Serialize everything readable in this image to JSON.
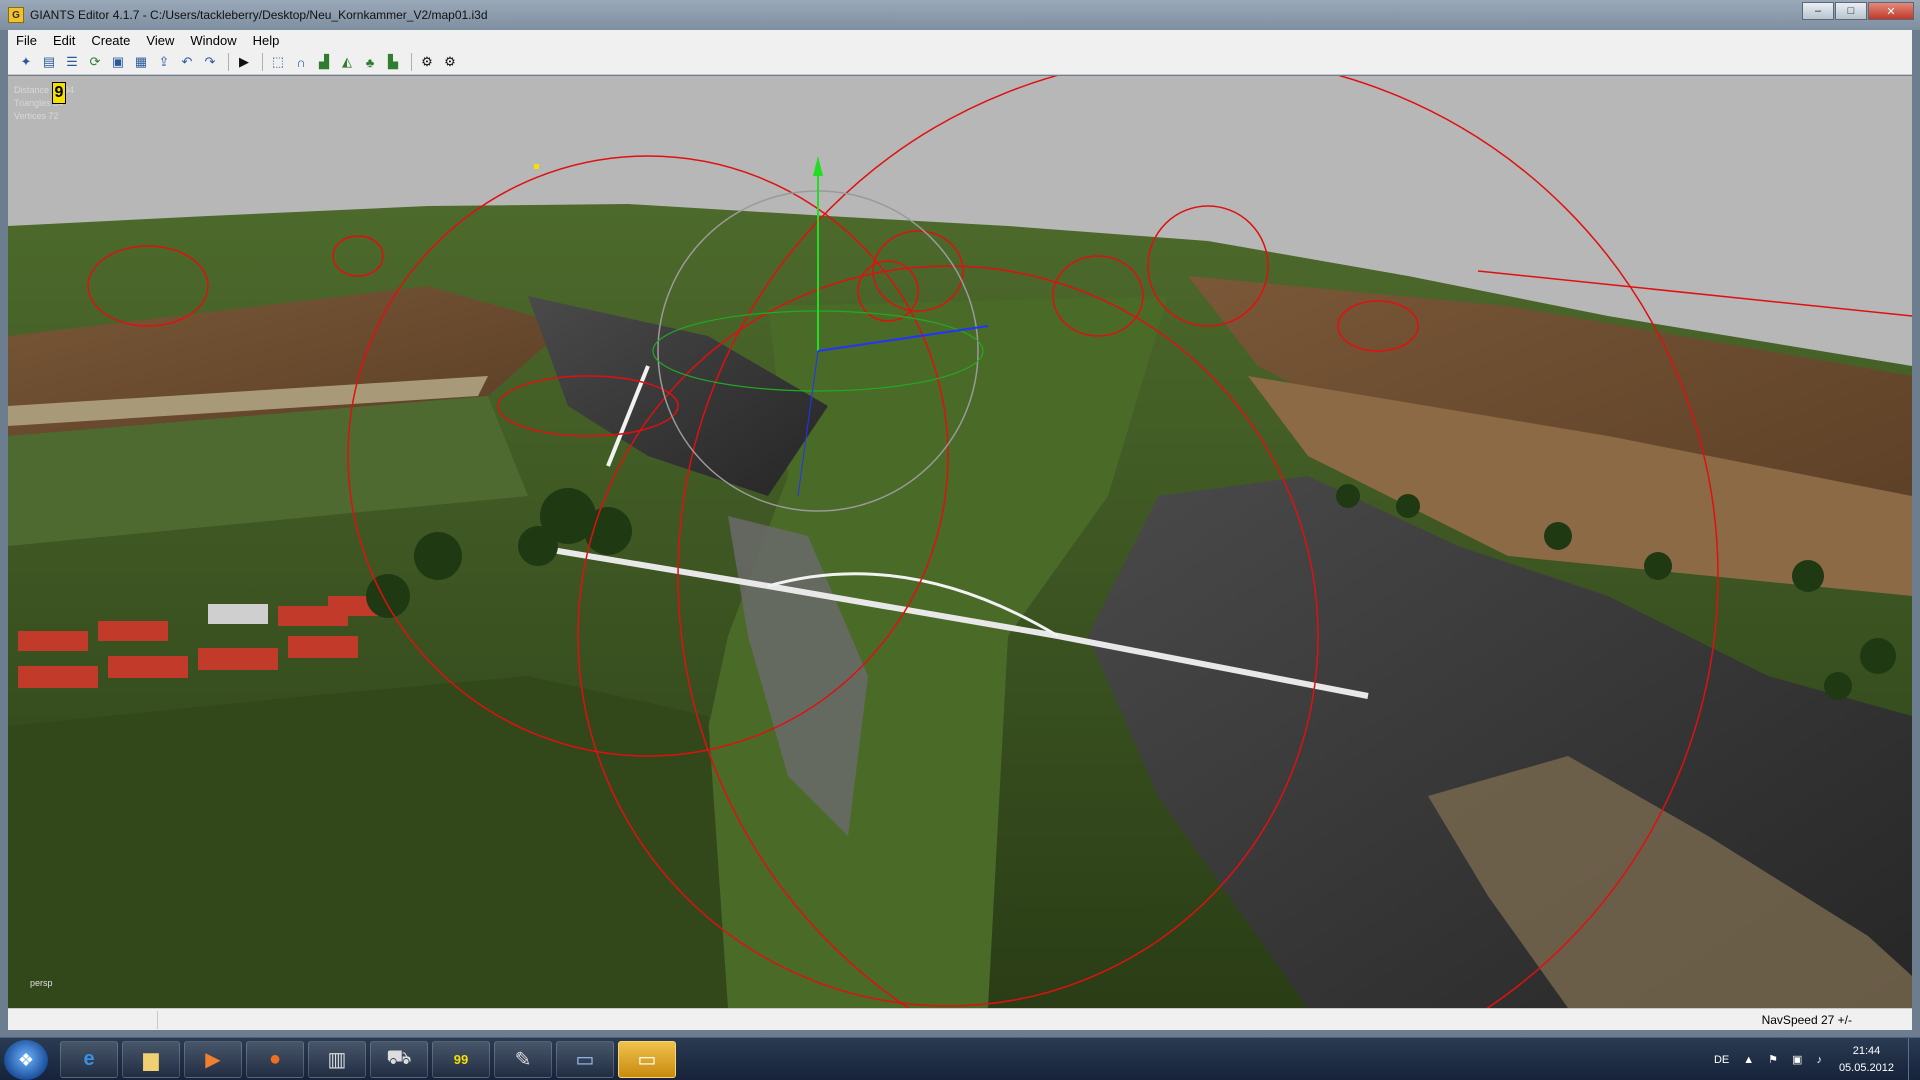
{
  "window": {
    "title": "GIANTS Editor 4.1.7 - C:/Users/tackleberry/Desktop/Neu_Kornkammer_V2/map01.i3d",
    "controls": {
      "minimize": "–",
      "maximize": "□",
      "close": "✕"
    }
  },
  "menu": {
    "items": [
      {
        "label": "File"
      },
      {
        "label": "Edit"
      },
      {
        "label": "Create"
      },
      {
        "label": "View"
      },
      {
        "label": "Window"
      },
      {
        "label": "Help"
      }
    ]
  },
  "toolbar": {
    "icons": [
      "new-icon",
      "open-icon",
      "properties-icon",
      "reload-icon",
      "save-icon",
      "save-as-icon",
      "export-icon",
      "undo-icon",
      "redo-icon",
      "play-icon",
      "select-icon",
      "move-icon",
      "terrain-paint-icon",
      "terrain-sculpt-icon",
      "foliage-icon",
      "terrain-info-icon",
      "settings-icon",
      "settings-alt-icon"
    ]
  },
  "viewport": {
    "stats": {
      "distance": "Distance 20 94",
      "triangles": "Triangles 54",
      "vertices": "Vertices 72",
      "badge": "9"
    },
    "camera_label": "persp"
  },
  "statusbar": {
    "navspeed": "NavSpeed 27 +/-"
  },
  "taskbar": {
    "apps": [
      "start-icon",
      "internet-explorer-icon",
      "file-explorer-icon",
      "media-player-icon",
      "firefox-icon",
      "calculator-icon",
      "tractor-icon",
      "editor-99-icon",
      "tool-icon",
      "window-manager-icon",
      "giants-editor-icon"
    ],
    "tray": {
      "language": "DE",
      "time": "21:44",
      "date": "05.05.2012"
    }
  },
  "colors": {
    "sky": "#b9b9b9",
    "terrain_green": "#3f5a22",
    "field_brown": "#6b4a30",
    "rock": "#3a3a3a",
    "gizmo_red": "#e01010",
    "gizmo_green": "#22dd22",
    "gizmo_blue": "#2233ff"
  }
}
